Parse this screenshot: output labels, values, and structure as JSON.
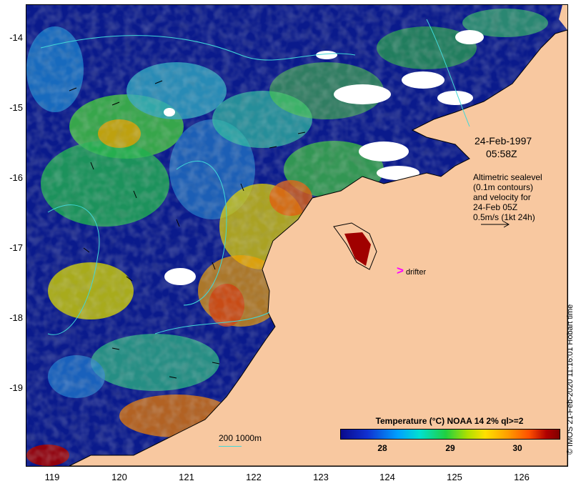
{
  "map": {
    "lat_labels": [
      "-14",
      "-15",
      "-16",
      "-17",
      "-18",
      "-19"
    ],
    "lon_labels": [
      "119",
      "120",
      "121",
      "122",
      "123",
      "124",
      "125",
      "126"
    ],
    "colors": {
      "ocean_cold": "#0a1a8c",
      "land": "#f8c8a0",
      "cloud": "#ffffff",
      "contour": "#40d8d8"
    }
  },
  "annotations": {
    "date": "24-Feb-1997",
    "time": "05:58Z",
    "sealevel_lines": [
      "Altimetric sealevel",
      "(0.1m contours)",
      "and velocity for",
      "24-Feb 05Z",
      "0.5m/s (1kt 24h)"
    ],
    "drifter_marker": ">",
    "drifter_label": "drifter",
    "depth_scale": "200  1000m"
  },
  "colorbar": {
    "title": "Temperature (°C) NOAA 14 2% ql>=2",
    "ticks": [
      "28",
      "29",
      "30"
    ]
  },
  "credit": "© IMOS 21-Feb-2020 11:16:01 Hobart time"
}
